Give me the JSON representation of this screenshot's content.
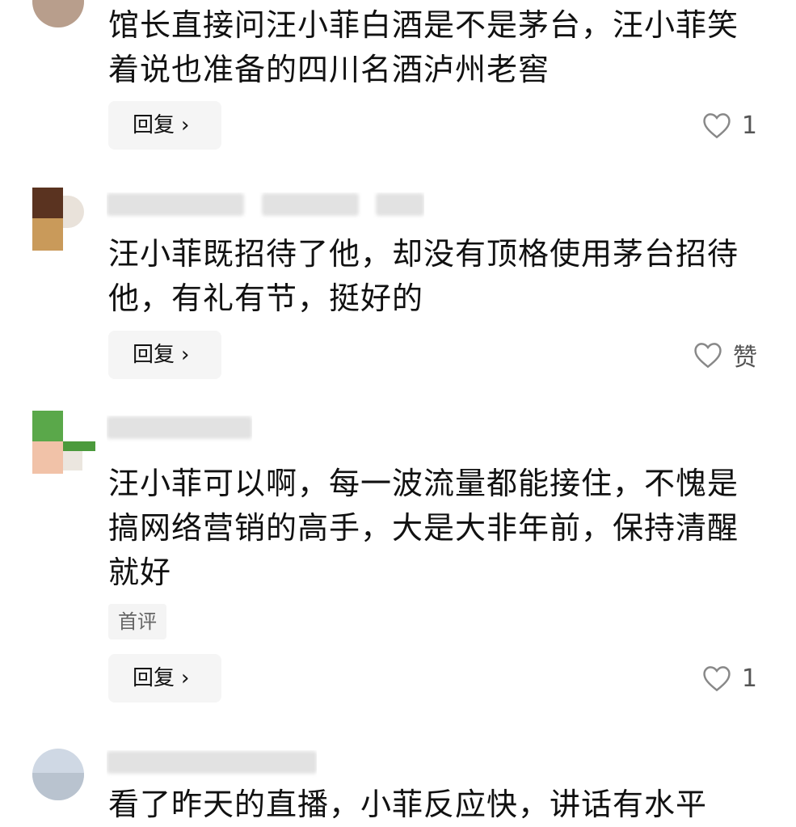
{
  "comments": [
    {
      "author_masked": "",
      "body": "馆长直接问汪小菲白酒是不是茅台，汪小菲笑着说也准备的四川名酒泸州老窖",
      "tag": "",
      "reply_label": "回复",
      "like_text": "1"
    },
    {
      "author_masked": "李教兽有料  2小时前",
      "body": "汪小菲既招待了他，却没有顶格使用茅台招待他，有礼有节，挺好的",
      "tag": "",
      "reply_label": "回复",
      "like_text": "赞"
    },
    {
      "author_masked": "一二聊历",
      "body": "汪小菲可以啊，每一波流量都能接住，不愧是搞网络营销的高手，大是大非年前，保持清醒就好",
      "tag": "首评",
      "reply_label": "回复",
      "like_text": "1"
    },
    {
      "author_masked": "广东",
      "body": "看了昨天的直播，小菲反应快，讲话有水平",
      "tag": "",
      "reply_label": "",
      "like_text": ""
    }
  ],
  "icons": {
    "heart": "heart-outline-icon",
    "chevron": "chevron-right-icon"
  },
  "colors": {
    "text": "#111111",
    "muted": "#c8c8c8",
    "button_bg": "#f5f5f5",
    "heart_stroke": "#888888"
  }
}
